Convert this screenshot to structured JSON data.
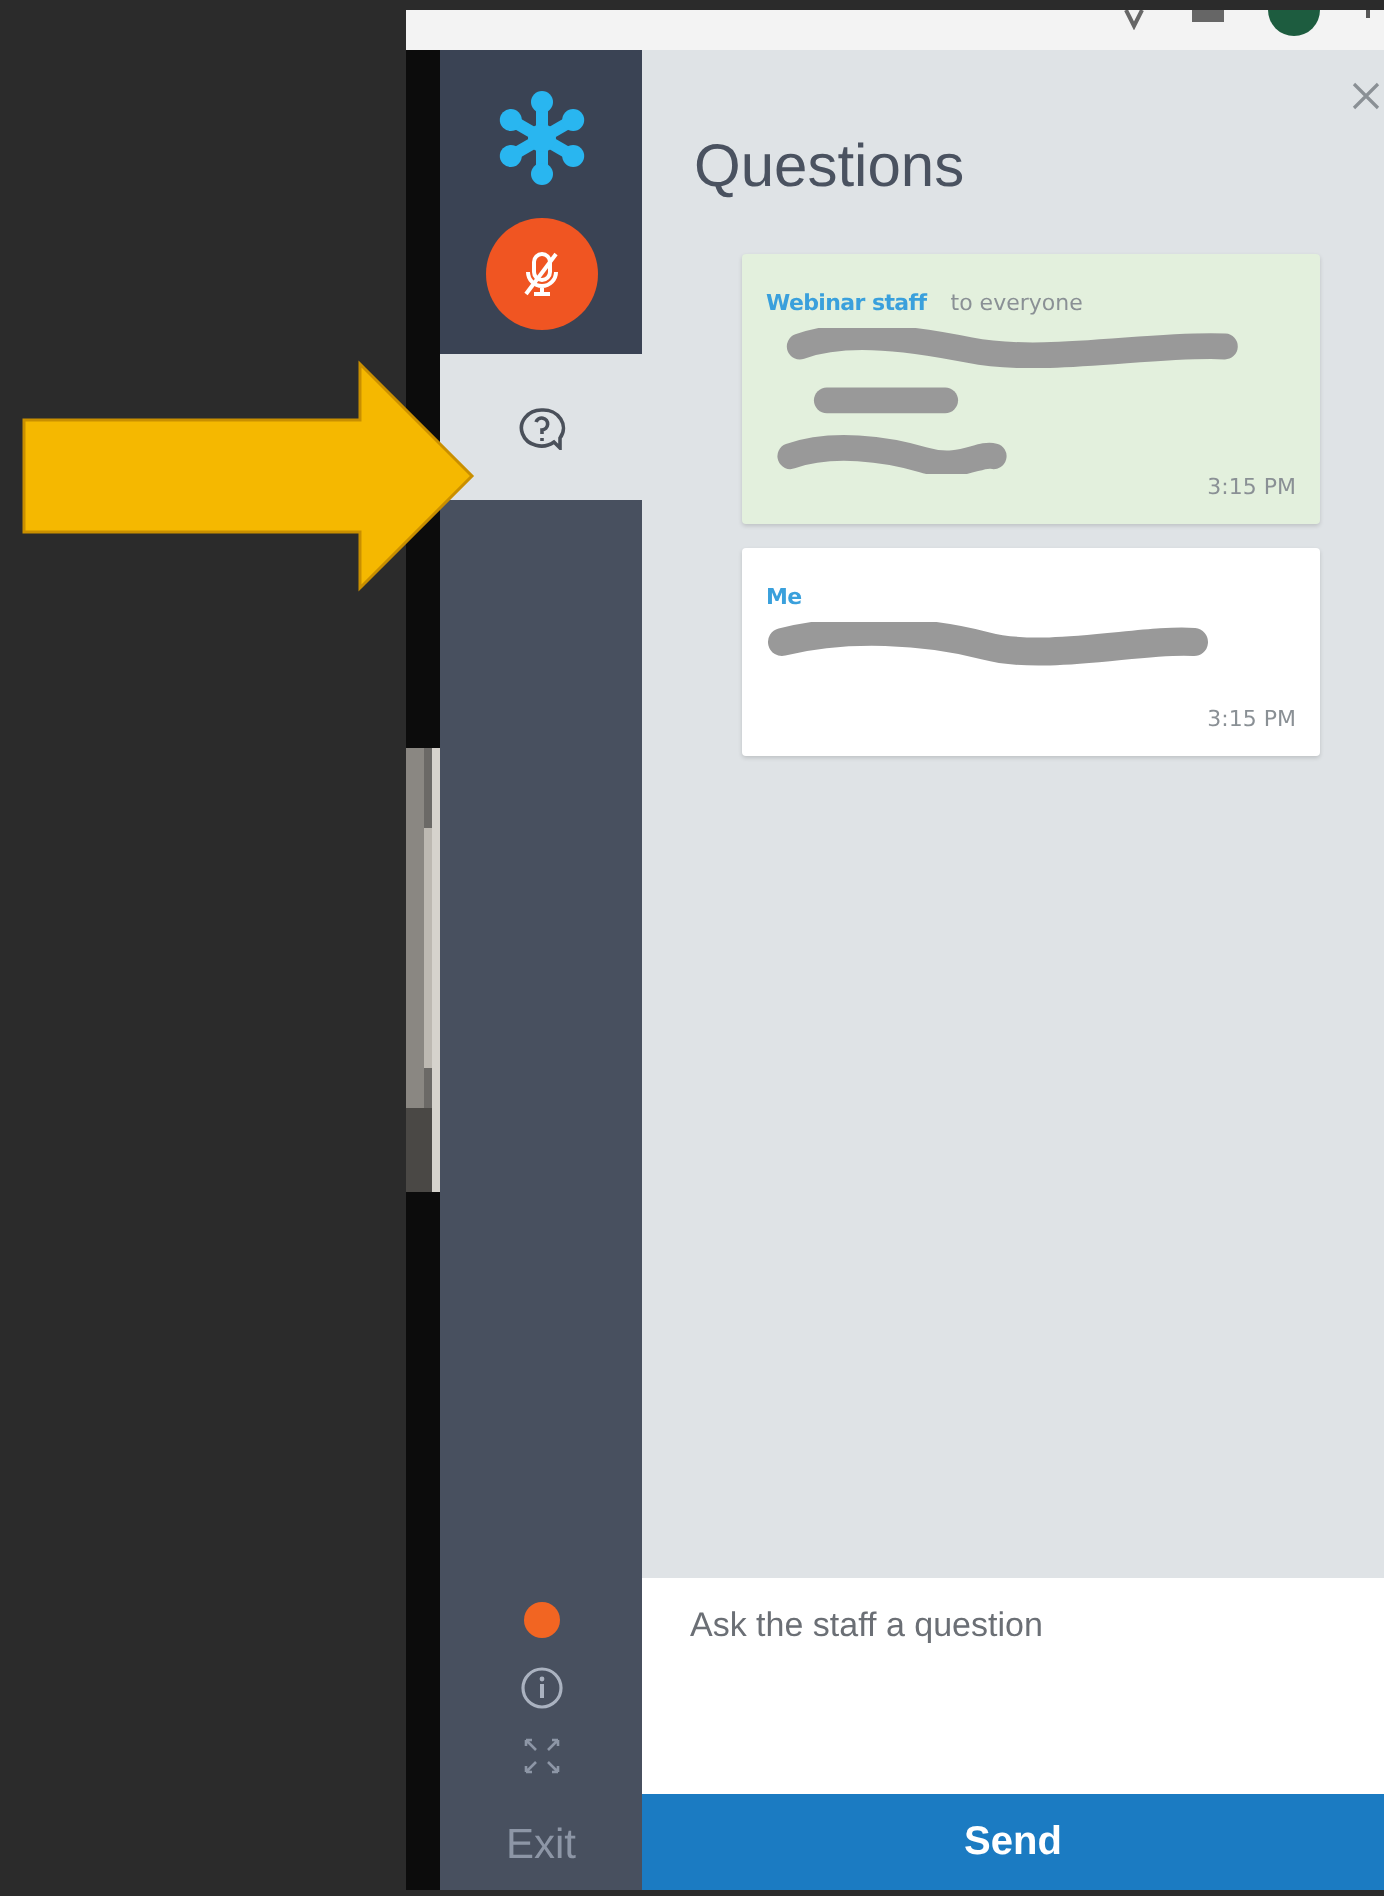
{
  "sidebar": {
    "mic": {
      "muted": true
    },
    "tabs": [
      {
        "kind": "questions",
        "selected": true
      }
    ],
    "status_dot": {
      "color": "#f26522"
    },
    "exit_label": "Exit"
  },
  "panel": {
    "title": "Questions",
    "messages": [
      {
        "kind": "staff",
        "sender": "Webinar staff",
        "audience": "to everyone",
        "time": "3:15 PM"
      },
      {
        "kind": "own",
        "sender": "Me",
        "time": "3:15 PM"
      }
    ]
  },
  "composer": {
    "placeholder": "Ask the staff a question",
    "send_label": "Send"
  }
}
